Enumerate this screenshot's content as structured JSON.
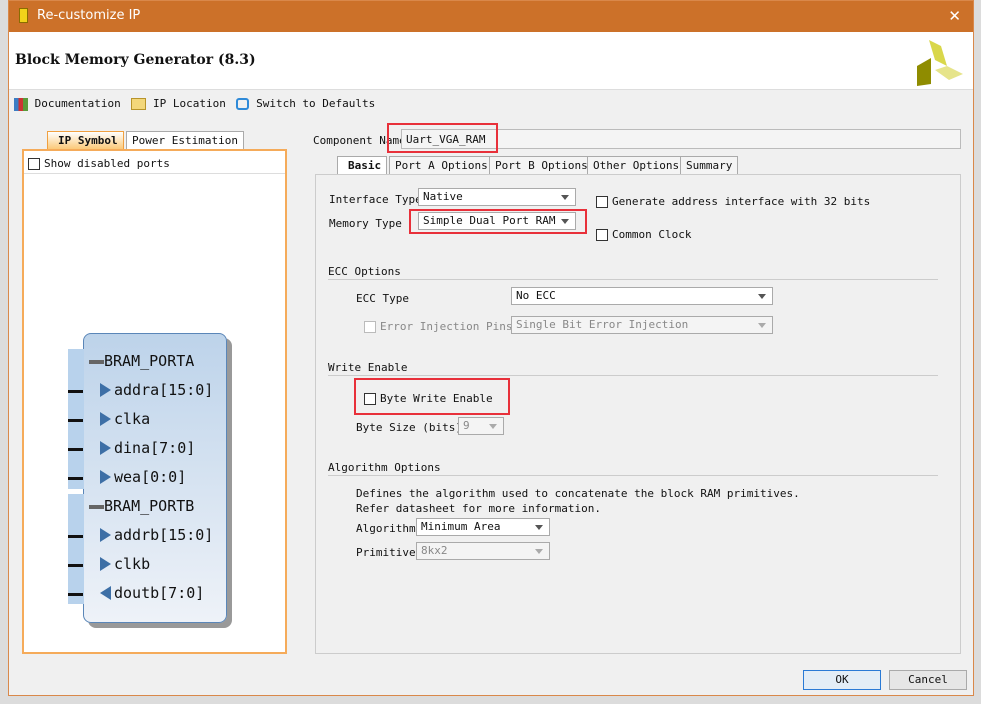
{
  "window": {
    "title": "Re-customize IP",
    "close": "✕"
  },
  "header": {
    "title": "Block Memory Generator (8.3)"
  },
  "toolbar": {
    "documentation": "Documentation",
    "ip_location": "IP Location",
    "switch_defaults": "Switch to Defaults"
  },
  "left": {
    "tabs": [
      "IP Symbol",
      "Power Estimation"
    ],
    "show_disabled": "Show disabled ports",
    "symbol": {
      "porta": "BRAM_PORTA",
      "portb": "BRAM_PORTB",
      "ports_a": [
        "addra[15:0]",
        "clka",
        "dina[7:0]",
        "wea[0:0]"
      ],
      "ports_b": [
        "addrb[15:0]",
        "clkb",
        "doutb[7:0]"
      ]
    }
  },
  "component": {
    "label": "Component Name",
    "value": "Uart_VGA_RAM"
  },
  "tabs": [
    "Basic",
    "Port A Options",
    "Port B Options",
    "Other Options",
    "Summary"
  ],
  "basic": {
    "interface_type_label": "Interface Type",
    "interface_type": "Native",
    "memory_type_label": "Memory Type",
    "memory_type": "Simple Dual Port RAM",
    "gen32": "Generate address interface with 32 bits",
    "common_clock": "Common Clock",
    "ecc_section": "ECC Options",
    "ecc_type_label": "ECC Type",
    "ecc_type": "No ECC",
    "error_injection_label": "Error Injection Pins",
    "error_injection": "Single Bit Error Injection",
    "we_section": "Write Enable",
    "byte_write": "Byte Write Enable",
    "byte_size_label": "Byte Size (bits)",
    "byte_size": "9",
    "algo_section": "Algorithm Options",
    "algo_desc1": "Defines the algorithm used to concatenate the block RAM primitives.",
    "algo_desc2": "Refer datasheet for more information.",
    "algorithm_label": "Algorithm",
    "algorithm": "Minimum Area",
    "primitive_label": "Primitive",
    "primitive": "8kx2"
  },
  "buttons": {
    "ok": "OK",
    "cancel": "Cancel"
  }
}
